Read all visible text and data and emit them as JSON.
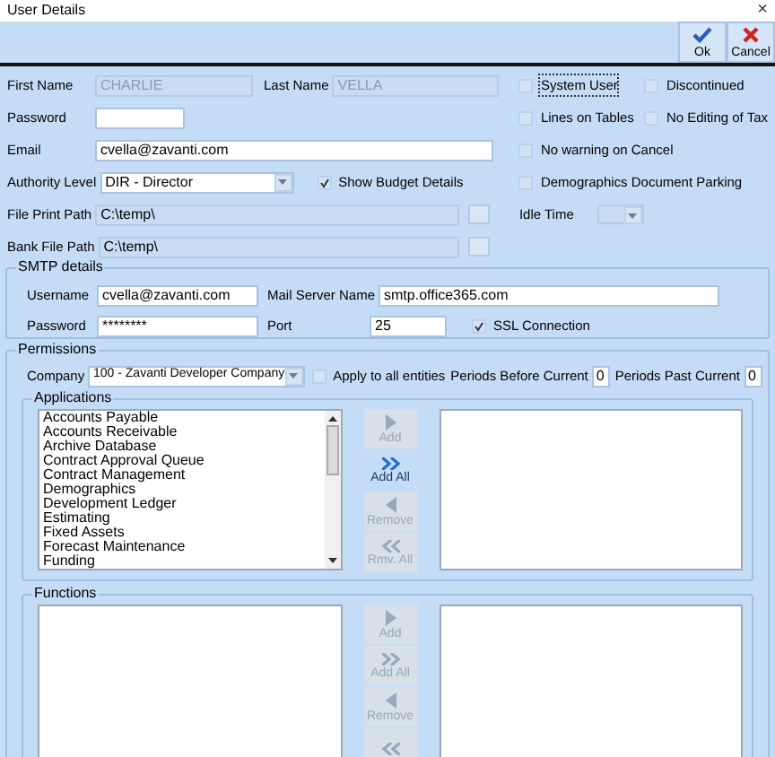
{
  "window": {
    "title": "User Details",
    "close": "×"
  },
  "toolbar": [
    {
      "kind": "ok",
      "label": "Ok"
    },
    {
      "kind": "cancel",
      "label": "Cancel"
    }
  ],
  "user": {
    "first_name": {
      "label": "First Name",
      "value": "CHARLIE",
      "disabled": true
    },
    "last_name": {
      "label": "Last Name",
      "value": "VELLA",
      "disabled": true
    },
    "password": {
      "label": "Password"
    },
    "email": {
      "label": "Email",
      "value": "cvella@zavanti.com"
    },
    "authority": {
      "label": "Authority Level",
      "value": "DIR - Director"
    },
    "show_budget": {
      "label": "Show Budget Details",
      "checked": true
    },
    "file_print_path": {
      "label": "File Print Path",
      "value": "C:\\temp\\"
    },
    "bank_file_path": {
      "label": "Bank File Path",
      "value": "C:\\temp\\"
    }
  },
  "options": [
    {
      "label": "System User",
      "checked": false,
      "focused": true
    },
    {
      "label": "Discontinued",
      "checked": false,
      "focused": false
    },
    {
      "label": "Lines on Tables",
      "checked": false,
      "focused": false
    },
    {
      "label": "No Editing of Tax",
      "checked": false,
      "focused": false
    },
    {
      "label": "No warning on Cancel",
      "checked": false,
      "focused": false
    },
    {
      "label": "Demographics Document Parking",
      "checked": false,
      "focused": false
    }
  ],
  "idle_time": {
    "label": "Idle Time"
  },
  "smtp": {
    "title": "SMTP details",
    "username": {
      "label": "Username",
      "value": "cvella@zavanti.com"
    },
    "password": {
      "label": "Password",
      "value": "********"
    },
    "server": {
      "label": "Mail Server Name",
      "value": "smtp.office365.com"
    },
    "port": {
      "label": "Port",
      "value": "25"
    },
    "ssl": {
      "label": "SSL Connection",
      "checked": true
    }
  },
  "permissions": {
    "title": "Permissions",
    "company": {
      "label": "Company",
      "value": "100 - Zavanti Developer Company"
    },
    "apply_all": {
      "label": "Apply to all entities",
      "checked": false
    },
    "periods_before": {
      "label": "Periods Before Current",
      "value": "0"
    },
    "periods_past": {
      "label": "Periods Past Current",
      "value": "0"
    },
    "applications": {
      "title": "Applications",
      "items": [
        "Accounts Payable",
        "Accounts Receivable",
        "Archive Database",
        "Contract Approval Queue",
        "Contract Management",
        "Demographics",
        "Development Ledger",
        "Estimating",
        "Fixed Assets",
        "Forecast Maintenance",
        "Funding"
      ],
      "buttons": [
        {
          "kind": "add",
          "label": "Add",
          "disabled": true
        },
        {
          "kind": "add_all",
          "label": "Add All",
          "disabled": false
        },
        {
          "kind": "remove",
          "label": "Remove",
          "disabled": true
        },
        {
          "kind": "remove_all",
          "label": "Rmv. All",
          "disabled": true
        }
      ]
    },
    "functions": {
      "title": "Functions",
      "buttons": [
        {
          "kind": "add",
          "label": "Add",
          "disabled": true
        },
        {
          "kind": "add_all",
          "label": "Add All",
          "disabled": true
        },
        {
          "kind": "remove",
          "label": "Remove",
          "disabled": true
        },
        {
          "kind": "remove_all",
          "disabled": true
        }
      ]
    }
  }
}
